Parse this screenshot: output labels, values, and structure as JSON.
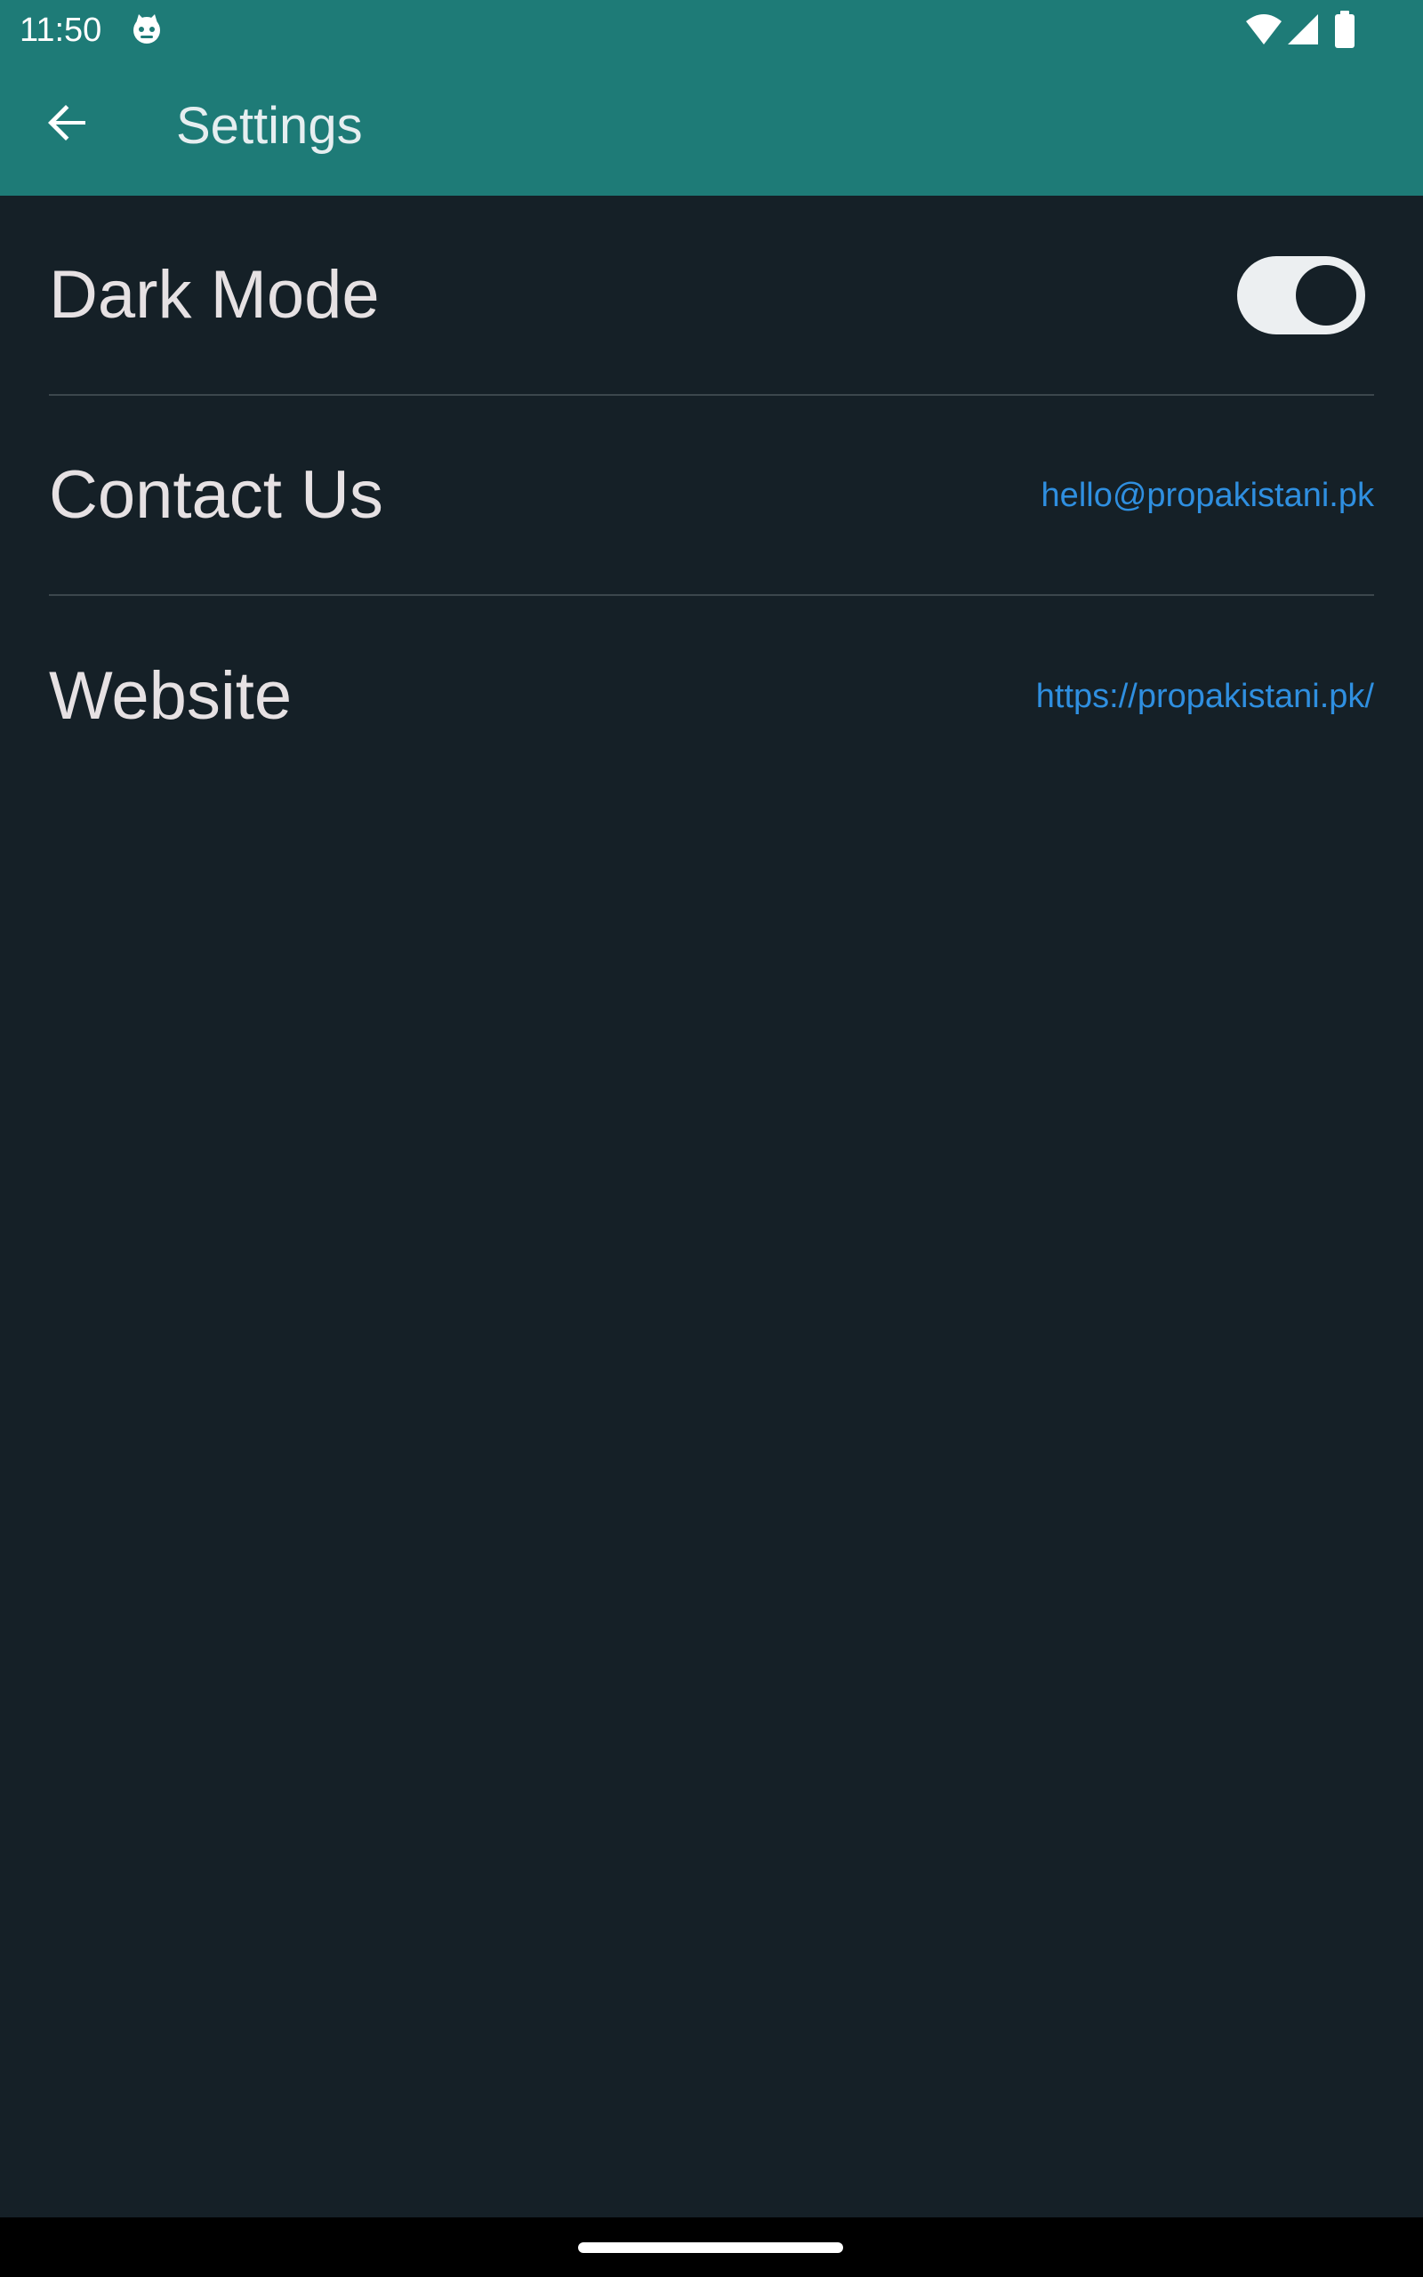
{
  "status_bar": {
    "time": "11:50",
    "notification_icon": "cat-face-icon",
    "icons": [
      "wifi-icon",
      "signal-icon",
      "battery-icon"
    ]
  },
  "app_bar": {
    "back_icon": "arrow-left-icon",
    "title": "Settings",
    "background_color": "#1e7b77"
  },
  "settings": {
    "dark_mode": {
      "label": "Dark Mode",
      "enabled": true
    },
    "contact": {
      "label": "Contact Us",
      "value": "hello@propakistani.pk"
    },
    "website": {
      "label": "Website",
      "value": "https://propakistani.pk/"
    }
  },
  "colors": {
    "background": "#152027",
    "link": "#2f8fe0",
    "text": "#e6e1e3"
  }
}
